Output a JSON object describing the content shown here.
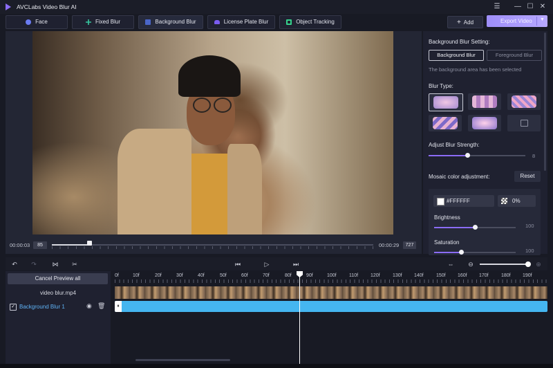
{
  "window": {
    "title": "AVCLabs Video Blur AI"
  },
  "toolbar": {
    "modes": [
      {
        "label": "Face",
        "color": "#6b7cf2"
      },
      {
        "label": "Fixed Blur",
        "color": "#36c9a0"
      },
      {
        "label": "Background Blur",
        "color": "#4a66c9"
      },
      {
        "label": "License Plate Blur",
        "color": "#7a5cf0"
      },
      {
        "label": "Object Tracking",
        "color": "#36d18b"
      }
    ],
    "add_label": "Add",
    "export_label": "Export Video"
  },
  "preview": {
    "current_time": "00:00:03",
    "current_frame": "85",
    "total_time": "00:00:29",
    "total_frames": "727",
    "progress": 0.117
  },
  "settings": {
    "section_title": "Background Blur Setting:",
    "seg_background": "Background Blur",
    "seg_foreground": "Foreground Blur",
    "status_text": "The background area has been selected",
    "blur_type_label": "Blur Type:",
    "blur_strength_label": "Adjust Blur Strength:",
    "blur_strength_value": "8",
    "blur_strength_fraction": 0.4,
    "mosaic_label": "Mosaic color adjustment:",
    "reset_label": "Reset",
    "color_value": "#FFFFFF",
    "opacity_value": "0%",
    "brightness_label": "Brightness",
    "brightness_value": "100",
    "brightness_fraction": 0.5,
    "saturation_label": "Saturation",
    "saturation_value": "100",
    "saturation_fraction": 0.33
  },
  "timeline": {
    "cancel_preview_label": "Cancel Preview all",
    "file_label": "video blur.mp4",
    "layer_label": "Background Blur 1",
    "ruler": [
      "0f",
      "10f",
      "20f",
      "30f",
      "40f",
      "50f",
      "60f",
      "70f",
      "80f",
      "90f",
      "100f",
      "110f",
      "120f",
      "130f",
      "140f",
      "150f",
      "160f",
      "170f",
      "180f",
      "190f"
    ],
    "playhead_frame": 85,
    "zoom": 1.0
  }
}
